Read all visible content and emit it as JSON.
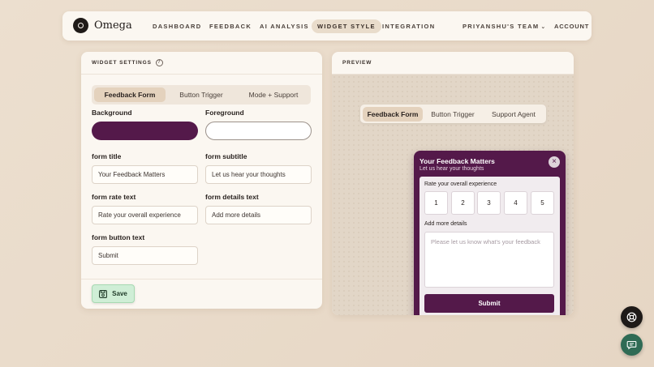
{
  "brand": {
    "name": "Omega"
  },
  "nav": {
    "links": [
      "DASHBOARD",
      "FEEDBACK",
      "AI ANALYSIS",
      "WIDGET STYLE",
      "INTEGRATION"
    ],
    "active": "WIDGET STYLE",
    "team": "PRIYANSHU'S TEAM",
    "account": "ACCOUNT"
  },
  "settings": {
    "title": "WIDGET SETTINGS",
    "tabs": [
      "Feedback Form",
      "Button Trigger",
      "Mode + Support"
    ],
    "active_tab": "Feedback Form",
    "background_label": "Background",
    "foreground_label": "Foreground",
    "background_color": "#54194a",
    "foreground_color": "#ffffff",
    "form_title_label": "form title",
    "form_title_value": "Your Feedback Matters",
    "form_subtitle_label": "form subtitle",
    "form_subtitle_value": "Let us hear your thoughts",
    "form_rate_label": "form rate text",
    "form_rate_value": "Rate your overall experience",
    "form_details_label": "form details text",
    "form_details_value": "Add more details",
    "form_button_label": "form button text",
    "form_button_value": "Submit",
    "save_label": "Save"
  },
  "preview": {
    "title": "PREVIEW",
    "tabs": [
      "Feedback Form",
      "Button Trigger",
      "Support Agent"
    ],
    "active_tab": "Feedback Form",
    "widget": {
      "title": "Your Feedback Matters",
      "subtitle": "Let us hear your thoughts",
      "rate_text": "Rate your overall experience",
      "ratings": [
        "1",
        "2",
        "3",
        "4",
        "5"
      ],
      "details_text": "Add more details",
      "textarea_placeholder": "Please let us know what's your feedback",
      "submit_label": "Submit"
    }
  },
  "icons": {
    "help": "help-circle-icon",
    "save": "floppy-disk-icon",
    "close": "close-icon",
    "support": "lifebuoy-icon",
    "chat": "chat-bubble-icon",
    "chevron": "chevron-down-icon"
  }
}
